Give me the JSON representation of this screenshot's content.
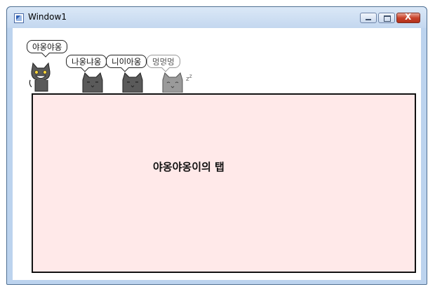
{
  "window": {
    "title": "Window1",
    "controls": {
      "minimize_icon": "minimize-icon",
      "maximize_icon": "maximize-icon",
      "close_icon": "close-icon",
      "close_glyph": "X"
    }
  },
  "tabs": [
    {
      "label": "야옹야옹",
      "selected": true,
      "cat": "laughing-cat-icon"
    },
    {
      "label": "나옹냐옹",
      "selected": false,
      "cat": "cat-icon"
    },
    {
      "label": "니이아옹",
      "selected": false,
      "cat": "cat-icon"
    },
    {
      "label": "멍멍멍",
      "selected": false,
      "cat": "sleeping-cat-icon"
    }
  ],
  "panel": {
    "content": "야옹야옹이의 탭",
    "background": "#ffe9e9"
  },
  "colors": {
    "titlebar": "#c3d7ef",
    "close_button": "#c8432b",
    "cat_dark": "#5a5a5a",
    "cat_light": "#9a9a9a"
  }
}
